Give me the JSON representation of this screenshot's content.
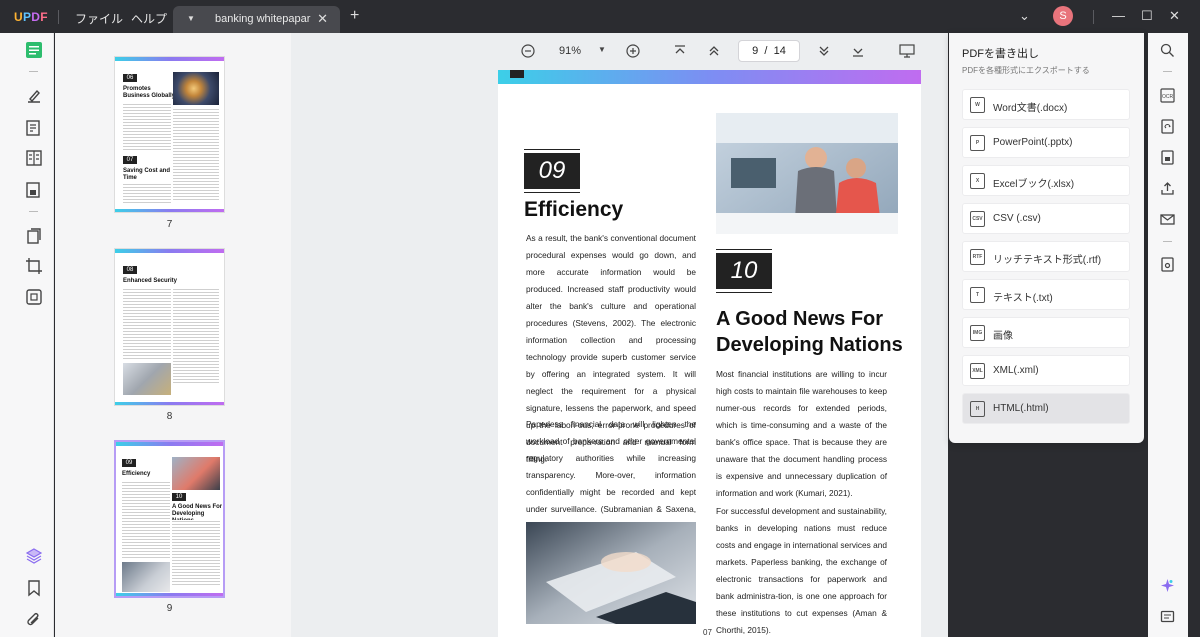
{
  "app": {
    "logo": "UPDF",
    "menu_file": "ファイル",
    "menu_help": "ヘルプ",
    "tab_title": "banking whitepapar",
    "avatar_initial": "S"
  },
  "thumbnails": [
    {
      "label": "7",
      "num1": "06",
      "head1": "Promotes Business Globally",
      "num2": "07",
      "head2": "Saving Cost and Time"
    },
    {
      "label": "8",
      "num1": "08",
      "head1": "Enhanced Security"
    },
    {
      "label": "9",
      "num1": "09",
      "head1": "Efficiency",
      "num2": "10",
      "head2": "A Good News For Developing Nations"
    }
  ],
  "toolbar": {
    "zoom": "91%",
    "current_page": "9",
    "page_sep": "/",
    "total_pages": "14"
  },
  "page": {
    "num1": "09",
    "title1": "Efficiency",
    "para1": "As a result, the bank's conventional document procedural expenses would go down, and more accurate information would be produced. Increased staff productivity would alter the bank's culture and operational procedures (Stevens, 2002). The electronic information collection and processing technology provide superb customer service by offering an integrated system. It will neglect the requirement for a physical signature, lessens the paperwork, and speed up the labori-ous, error-prone procedures of document prepa-ration and manual form filling.",
    "para2": "Paperless financial data will lighten the workload of bankers and other governmental regulatory authorities while increasing transparency. More-over, information confidentially might be recorded and kept under surveillance. (Subramanian & Saxena, 2008).",
    "num2": "10",
    "title2_line1": "A Good News For",
    "title2_line2": "Developing Nations",
    "para3": "Most financial institutions are willing to incur high costs to maintain file warehouses to keep numer-ous records for extended periods, which is time-consuming and a waste of the bank's office space. That is because they are unaware that the document handling process is expensive and unnecessary duplication of information and work (Kumari, 2021).",
    "para4": "For successful development and sustainability, banks in developing nations must reduce costs and engage in international services and markets. Paperless banking, the exchange of electronic transactions for paperwork and bank administra-tion, is one one approach for these institutions to cut expenses (Aman & Chorthi, 2015).",
    "page_number": "07"
  },
  "export": {
    "title": "PDFを書き出し",
    "subtitle": "PDFを各種形式にエクスポートする",
    "items": [
      {
        "label": "Word文書(.docx)",
        "icon": "W"
      },
      {
        "label": "PowerPoint(.pptx)",
        "icon": "P"
      },
      {
        "label": "Excelブック(.xlsx)",
        "icon": "X"
      },
      {
        "label": "CSV (.csv)",
        "icon": "CSV"
      },
      {
        "label": "リッチテキスト形式(.rtf)",
        "icon": "RTF"
      },
      {
        "label": "テキスト(.txt)",
        "icon": "T"
      },
      {
        "label": "画像",
        "icon": "IMG"
      },
      {
        "label": "XML(.xml)",
        "icon": "XML"
      },
      {
        "label": "HTML(.html)",
        "icon": "H"
      }
    ]
  }
}
